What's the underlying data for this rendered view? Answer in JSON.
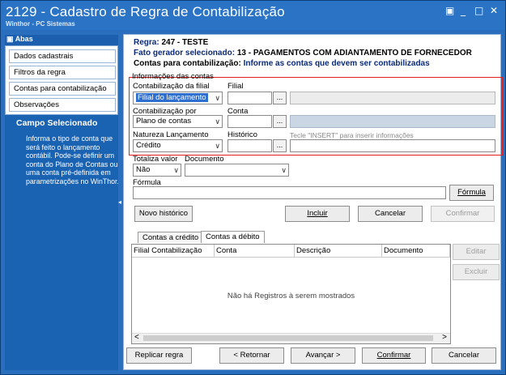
{
  "window": {
    "title": "2129 - Cadastro de Regra de Contabilização",
    "subtitle": "Winthor - PC Sistemas",
    "controls": {
      "restore": "▣",
      "minimize": "_",
      "maximize": "□",
      "close": "✕"
    }
  },
  "sidebar": {
    "header": "Abas",
    "header_icon": "▣",
    "items": [
      {
        "label": "Dados cadastrais"
      },
      {
        "label": "Filtros da regra"
      },
      {
        "label": "Contas para contabilização"
      },
      {
        "label": "Observações"
      }
    ],
    "campo_title": "Campo Selecionado",
    "campo_lines": [
      "Informa o tipo de conta que",
      "será feito o lançamento",
      "contábil. Pode-se definir um",
      "conta do Plano de Contas ou",
      "uma conta pré-definida em",
      "parametrizações no WinThor."
    ],
    "splitter": "◂"
  },
  "header": {
    "regra_label": "Regra:",
    "regra_value": "247 - TESTE",
    "fato_label": "Fato gerador selecionado:",
    "fato_value": "13 - PAGAMENTOS COM ADIANTAMENTO DE FORNECEDOR",
    "contas_label": "Contas para contabilização:",
    "contas_value": "Informe as contas que devem ser contabilizadas"
  },
  "info": {
    "group_label": "Informações das contas",
    "contab_filial_label": "Contabilização da filial",
    "contab_filial_value": "Filial do lançamento",
    "filial_label": "Filial",
    "filial_value": "",
    "contab_por_label": "Contabilização por",
    "contab_por_value": "Plano de contas",
    "conta_label": "Conta",
    "conta_value": "",
    "natureza_label": "Natureza Lançamento",
    "natureza_value": "Crédito",
    "historico_label": "Histórico",
    "historico_hint": "Tecle \"INSERT\" para inserir informações",
    "dots": "..."
  },
  "form": {
    "totaliza_label": "Totaliza valor",
    "totaliza_value": "Não",
    "documento_label": "Documento",
    "documento_value": "",
    "formula_label": "Fórmula",
    "formula_value": "",
    "formula_button": "Fórmula"
  },
  "actions": {
    "novo_historico": "Novo histórico",
    "incluir": "Incluir",
    "cancelar": "Cancelar",
    "confirmar": "Confirmar"
  },
  "tabs": [
    {
      "label": "Contas a crédito"
    },
    {
      "label": "Contas a débito"
    }
  ],
  "grid": {
    "columns": [
      "Filial Contabilização",
      "Conta",
      "Descrição",
      "Documento"
    ],
    "empty_message": "Não há Registros à serem mostrados",
    "scroll_left": "<",
    "scroll_right": ">"
  },
  "side_buttons": {
    "editar": "Editar",
    "excluir": "Excluir"
  },
  "footer": {
    "replicar": "Replicar regra",
    "retornar": "< Retornar",
    "avancar": "Avançar >",
    "confirmar": "Confirmar",
    "cancelar": "Cancelar"
  },
  "colors": {
    "titlebar": "#2b73c4",
    "sidebar": "#1a62b2",
    "accent_text": "#0a2a78",
    "highlight_box": "#e02020"
  }
}
